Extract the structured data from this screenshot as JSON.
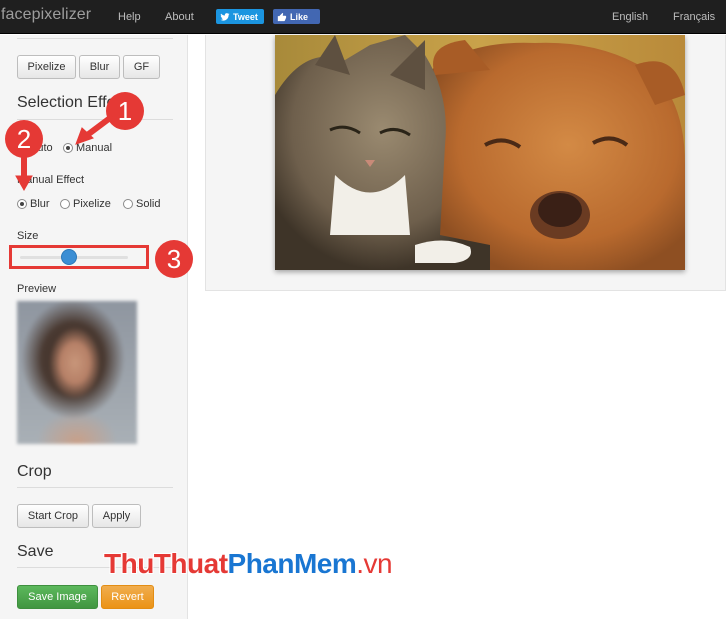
{
  "navbar": {
    "brand": "facepixelizer",
    "help": "Help",
    "about": "About",
    "tweet": "Tweet",
    "like": "Like",
    "lang_en": "English",
    "lang_fr": "Français"
  },
  "sidebar": {
    "mode_buttons": [
      "Pixelize",
      "Blur",
      "GF"
    ],
    "selection_title": "Selection Effect",
    "auto_label": "Auto",
    "manual_label": "Manual",
    "manual_effect_label": "Manual Effect",
    "effects": [
      "Blur",
      "Pixelize",
      "Solid"
    ],
    "selected_effect": "Blur",
    "size_label": "Size",
    "size_value_fraction": 0.45,
    "preview_label": "Preview",
    "crop_title": "Crop",
    "start_crop": "Start Crop",
    "apply": "Apply",
    "save_title": "Save",
    "save_image": "Save Image",
    "revert": "Revert"
  },
  "annotations": {
    "markers": [
      "1",
      "2",
      "3"
    ],
    "watermark_a": "ThuThuat",
    "watermark_b": "PhanMem",
    "watermark_c": ".vn",
    "color": "#e53935"
  },
  "colors": {
    "navbar": "#1f1f1f",
    "tweet": "#1b95e0",
    "like": "#4267b2",
    "slider": "#3b8ed4",
    "success": "#5cb85c",
    "warning": "#f0ad4e"
  }
}
